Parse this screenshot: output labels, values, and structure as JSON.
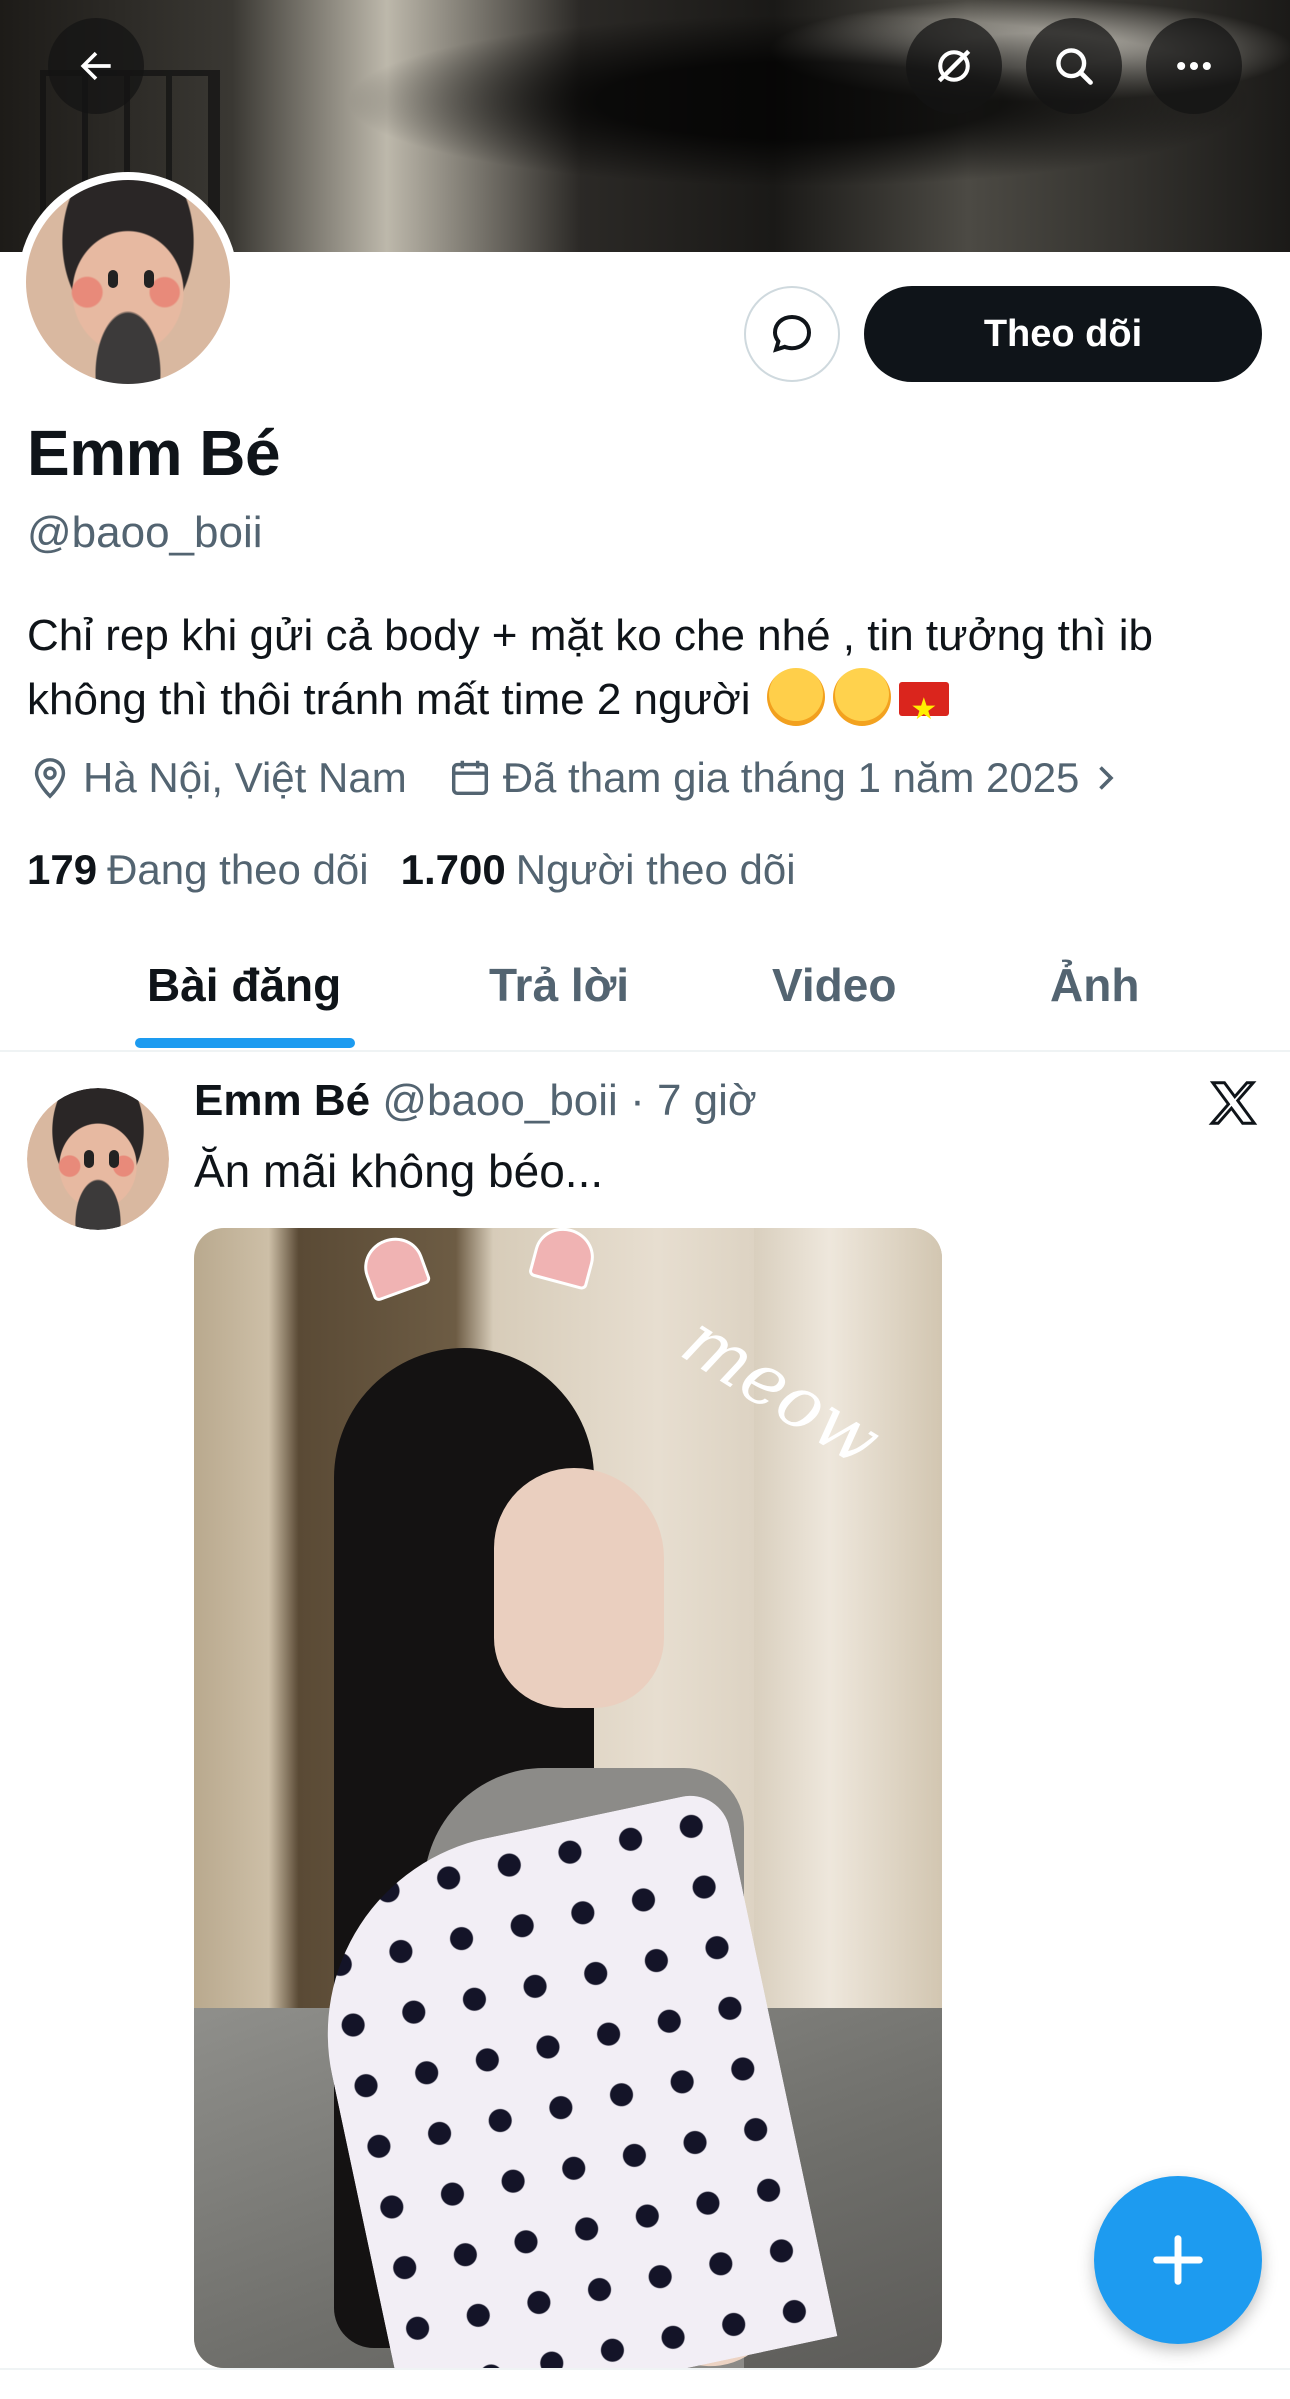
{
  "header": {
    "back_icon": "arrow-left-icon",
    "grok_icon": "grok-icon",
    "search_icon": "search-icon",
    "more_icon": "more-dots-icon"
  },
  "profile": {
    "name": "Emm Bé",
    "handle": "@baoo_boii",
    "follow_label": "Theo dõi",
    "bio_text": "Chỉ rep khi gửi cả body + mặt ko che nhé , tin tưởng thì ib không thì thôi tránh mất time 2 người",
    "location": "Hà Nội, Việt Nam",
    "joined": "Đã tham gia tháng 1 năm 2025",
    "following_count": "179",
    "following_label": "Đang theo dõi",
    "followers_count": "1.700",
    "followers_label": "Người theo dõi"
  },
  "tabs": [
    {
      "label": "Bài đăng",
      "active": true
    },
    {
      "label": "Trả lời",
      "active": false
    },
    {
      "label": "Video",
      "active": false
    },
    {
      "label": "Ảnh",
      "active": false
    }
  ],
  "post": {
    "author": "Emm Bé",
    "handle": "@baoo_boii",
    "time": "· 7 giờ",
    "text": "Ăn mãi không béo...",
    "media_overlay": "meow"
  },
  "colors": {
    "accent": "#1d9bf0",
    "text_primary": "#0f1419",
    "text_secondary": "#536471",
    "button_dark": "#0f1419"
  }
}
